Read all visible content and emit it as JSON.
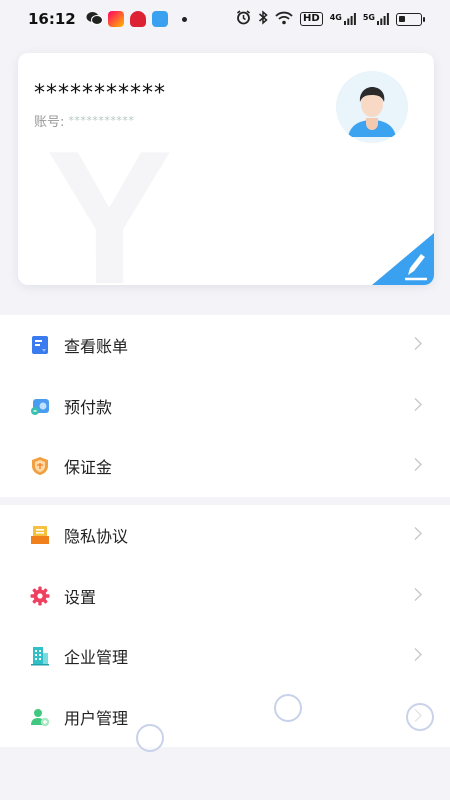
{
  "status_bar": {
    "time": "16:12",
    "network_1": "4G",
    "network_2": "5G",
    "hd_label": "HD",
    "battery_level": 0.3
  },
  "profile": {
    "name": "***********",
    "account_label": "账号:",
    "account_value": "***********",
    "watermark": "Y",
    "avatar_icon": "user-avatar",
    "edit_icon": "pen-icon"
  },
  "menu": {
    "group1": [
      {
        "label": "查看账单",
        "icon": "bill-icon",
        "color": "#3a7bf0"
      },
      {
        "label": "预付款",
        "icon": "prepay-icon",
        "color": "#4a9cf0"
      },
      {
        "label": "保证金",
        "icon": "shield-icon",
        "color": "#f0a040"
      }
    ],
    "group2": [
      {
        "label": "隐私协议",
        "icon": "privacy-icon",
        "color": "#f0a020"
      },
      {
        "label": "设置",
        "icon": "gear-icon",
        "color": "#f04060"
      },
      {
        "label": "企业管理",
        "icon": "building-icon",
        "color": "#30c0c8"
      },
      {
        "label": "用户管理",
        "icon": "user-manage-icon",
        "color": "#40c880"
      }
    ]
  },
  "colors": {
    "accent": "#3aa0f0",
    "background": "#f4f4f8"
  }
}
